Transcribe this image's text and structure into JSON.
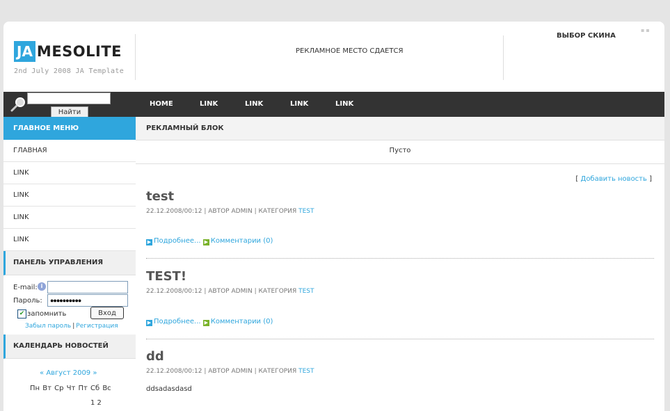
{
  "header": {
    "logo_box": "JA",
    "logo_word": "MESOLITE",
    "logo_sub": "2nd July 2008 JA Template",
    "ad_text": "РЕКЛАМНОЕ МЕСТО СДАЕТСЯ",
    "skin_label": "ВЫБОР СКИНА"
  },
  "search": {
    "value": "",
    "button": "Найти"
  },
  "nav": [
    "HOME",
    "LINK",
    "LINK",
    "LINK",
    "LINK"
  ],
  "left": {
    "main_menu_title": "ГЛАВНОЕ МЕНЮ",
    "main_menu": [
      "ГЛАВНАЯ",
      "LINK",
      "LINK",
      "LINK",
      "LINK"
    ],
    "panel_title": "ПАНЕЛЬ УПРАВЛЕНИЯ",
    "login": {
      "email_label": "E-mail:",
      "email_value": "",
      "password_label": "Пароль:",
      "password_value": "●●●●●●●●●●",
      "remember_label": "запомнить",
      "remember_checked": true,
      "submit": "Вход",
      "forgot": "Забыл пароль",
      "register": "Регистрация"
    },
    "calendar_title": "КАЛЕНДАРЬ НОВОСТЕЙ",
    "calendar": {
      "prev": "«",
      "month": "Август 2009",
      "next": "»",
      "days": "Пн Вт Ср Чт Пт Сб Вс",
      "first_row": "1   2"
    }
  },
  "main": {
    "ad_block_title": "РЕКЛАМНЫЙ БЛОК",
    "ad_block_body": "Пусто",
    "add_news": "Добавить новость",
    "posts": [
      {
        "title": "test",
        "date": "22.12.2008/00:12",
        "author_label": "АВТОР",
        "author": "ADMIN",
        "category_label": "КАТЕГОРИЯ",
        "category": "TEST",
        "more": "Подробнее...",
        "comments": "Комментарии (0)"
      },
      {
        "title": "TEST!",
        "date": "22.12.2008/00:12",
        "author_label": "АВТОР",
        "author": "ADMIN",
        "category_label": "КАТЕГОРИЯ",
        "category": "TEST",
        "more": "Подробнее...",
        "comments": "Комментарии (0)"
      },
      {
        "title": "dd",
        "date": "22.12.2008/00:12",
        "author_label": "АВТОР",
        "author": "ADMIN",
        "category_label": "КАТЕГОРИЯ",
        "category": "TEST",
        "body": "ddsadasdasd"
      }
    ]
  },
  "colors": {
    "accent": "#2fa6dd",
    "dark": "#333333",
    "green": "#7ab22a"
  }
}
